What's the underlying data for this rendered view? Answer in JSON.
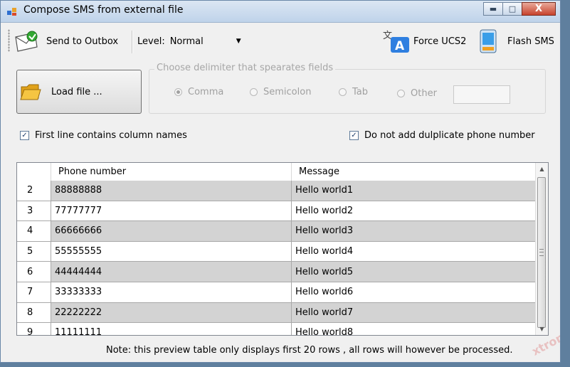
{
  "window": {
    "title": "Compose SMS from external file",
    "close_label": "X"
  },
  "toolbar": {
    "send_label": "Send to Outbox",
    "level_label": "Level:",
    "level_value": "Normal",
    "force_label": "Force UCS2",
    "flash_label": "Flash SMS"
  },
  "load_button": {
    "label": "Load file ..."
  },
  "delimiter": {
    "legend": "Choose delimiter that spearates fields",
    "options": [
      "Comma",
      "Semicolon",
      "Tab",
      "Other"
    ],
    "selected": "Comma",
    "other_value": ""
  },
  "checkboxes": {
    "first_line": {
      "label": "First line contains column names",
      "checked": true
    },
    "no_duplicate": {
      "label": "Do not add dulplicate phone number",
      "checked": true
    }
  },
  "table": {
    "columns": [
      "",
      "Phone number",
      "Message"
    ],
    "rows": [
      [
        "2",
        "88888888",
        "Hello world1"
      ],
      [
        "3",
        "77777777",
        "Hello world2"
      ],
      [
        "4",
        "66666666",
        "Hello world3"
      ],
      [
        "5",
        "55555555",
        "Hello world4"
      ],
      [
        "6",
        "44444444",
        "Hello world5"
      ],
      [
        "7",
        "33333333",
        "Hello world6"
      ],
      [
        "8",
        "22222222",
        "Hello world7"
      ],
      [
        "9",
        "11111111",
        "Hello world8"
      ]
    ]
  },
  "note": "Note: this preview table only displays first 20 rows , all rows will however be processed.",
  "watermark": "xtronic",
  "icons": {
    "app": "app-icon",
    "send": "envelope-send-icon",
    "force": "translate-icon",
    "flash": "phone-icon",
    "load": "folder-icon"
  },
  "colors": {
    "title_bg": "#bfd3ea",
    "alt_row": "#d3d3d3",
    "close_button": "#c7432d"
  }
}
